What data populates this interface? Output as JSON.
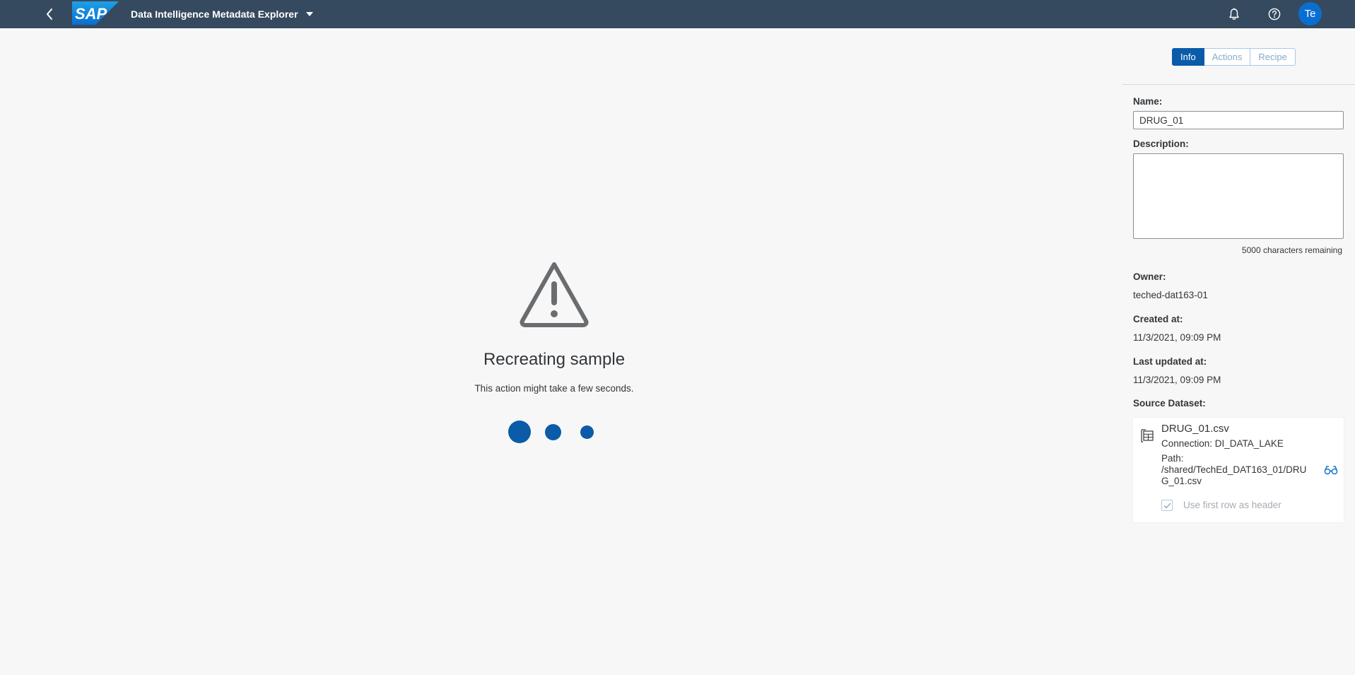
{
  "shell": {
    "logo_text": "SAP",
    "app_title": "Data Intelligence Metadata Explorer",
    "avatar_initials": "Te",
    "icons": [
      "back-icon",
      "bell-icon",
      "help-icon",
      "chevron-down-icon"
    ]
  },
  "loading": {
    "title": "Recreating sample",
    "subtitle": "This action might take a few seconds.",
    "icon": "warning-icon"
  },
  "panel": {
    "tabs": [
      {
        "label": "Info",
        "active": true
      },
      {
        "label": "Actions",
        "active": false
      },
      {
        "label": "Recipe",
        "active": false
      }
    ],
    "name_label": "Name:",
    "name_value": "DRUG_01",
    "description_label": "Description:",
    "description_value": "",
    "char_remaining": "5000 characters remaining",
    "owner_label": "Owner:",
    "owner_value": "teched-dat163-01",
    "created_label": "Created at:",
    "created_value": "11/3/2021, 09:09 PM",
    "updated_label": "Last updated at:",
    "updated_value": "11/3/2021, 09:09 PM",
    "source_label": "Source Dataset:",
    "dataset": {
      "name": "DRUG_01.csv",
      "connection": "Connection: DI_DATA_LAKE",
      "path_label": "Path:",
      "path": "/shared/TechEd_DAT163_01/DRUG_01.csv",
      "header_checkbox_label": "Use first row as header",
      "header_checkbox_checked": true
    }
  },
  "colors": {
    "shell_bg": "#354a5f",
    "accent": "#0a6ed1",
    "active_tab": "#0a5ba9",
    "page_bg": "#f7f7f7"
  }
}
